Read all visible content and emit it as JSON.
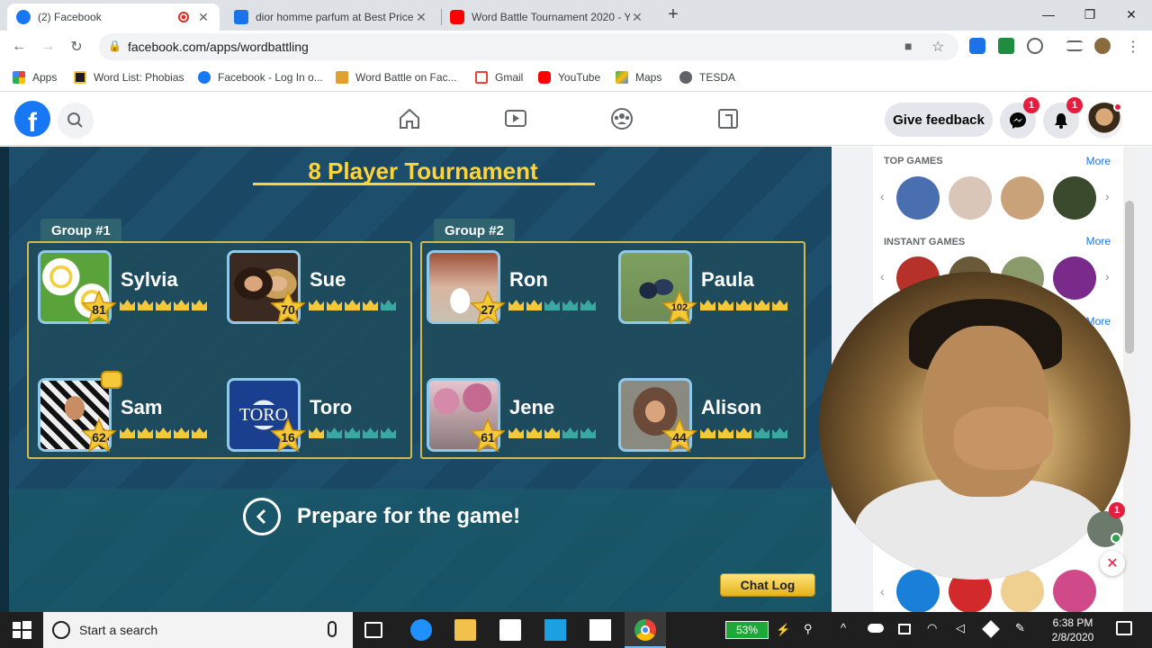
{
  "browser": {
    "tabs": [
      {
        "title": "(2) Facebook",
        "favicon_color": "#1877f2",
        "active": true
      },
      {
        "title": "dior homme parfum at Best Price",
        "favicon_color": "#1a73e8",
        "active": false
      },
      {
        "title": "Word Battle Tournament 2020 - Y",
        "favicon_color": "#ff0000",
        "active": false
      }
    ],
    "new_tab_label": "+",
    "url": "facebook.com/apps/wordbattling",
    "bookmarks": [
      {
        "label": "Apps",
        "icon": "apps-grid-icon"
      },
      {
        "label": "Word List: Phobias",
        "icon": "word-list-icon"
      },
      {
        "label": "Facebook - Log In o...",
        "icon": "facebook-icon"
      },
      {
        "label": "Word Battle on Fac...",
        "icon": "word-battle-icon"
      },
      {
        "label": "Gmail",
        "icon": "gmail-icon"
      },
      {
        "label": "YouTube",
        "icon": "youtube-icon"
      },
      {
        "label": "Maps",
        "icon": "maps-icon"
      },
      {
        "label": "TESDA",
        "icon": "globe-icon"
      }
    ]
  },
  "facebook": {
    "logo": "f",
    "feedback_label": "Give feedback",
    "messenger_badge": "1",
    "notifications_badge": "1"
  },
  "game": {
    "title": "8 Player Tournament",
    "groups": [
      {
        "label": "Group #1",
        "players": [
          {
            "name": "Sylvia",
            "level": "81",
            "crowns_filled": 5,
            "avatar_color": "#5aa33b"
          },
          {
            "name": "Sue",
            "level": "70",
            "crowns_filled": 4,
            "avatar_color": "#3b2a22"
          },
          {
            "name": "Sam",
            "level": "62",
            "crowns_filled": 5,
            "avatar_color": "#b8b8b8"
          },
          {
            "name": "Toro",
            "level": "16",
            "crowns_filled": 1,
            "avatar_color": "#1b3f8f",
            "avatar_text": "TORO"
          }
        ]
      },
      {
        "label": "Group #2",
        "players": [
          {
            "name": "Ron",
            "level": "27",
            "crowns_filled": 2,
            "avatar_color": "#d8b5a0"
          },
          {
            "name": "Paula",
            "level": "102",
            "crowns_filled": 5,
            "avatar_color": "#6e8b55"
          },
          {
            "name": "Jene",
            "level": "61",
            "crowns_filled": 3,
            "avatar_color": "#e8c4cf"
          },
          {
            "name": "Alison",
            "level": "44",
            "crowns_filled": 3,
            "avatar_color": "#6b4a3a"
          }
        ]
      }
    ],
    "prepare_label": "Prepare for the game!",
    "chat_log_label": "Chat Log"
  },
  "sidebar": {
    "top_games_label": "TOP GAMES",
    "instant_games_label": "INSTANT GAMES",
    "more_label": "More",
    "top_games_colors": [
      "#4a6fb0",
      "#d9c6b8",
      "#c9a27a",
      "#3a4a2c"
    ],
    "instant_games_colors": [
      "#b7312b",
      "#6a5a3a",
      "#8a9a6a",
      "#7a2a8a"
    ],
    "bottom_games_colors": [
      "#1a7fd8",
      "#d22a2a",
      "#f0d090",
      "#d04a8a"
    ],
    "notification_badge": "1"
  },
  "taskbar": {
    "search_placeholder": "Start a search",
    "battery": "53%",
    "time": "6:38 PM",
    "date": "2/8/2020"
  }
}
